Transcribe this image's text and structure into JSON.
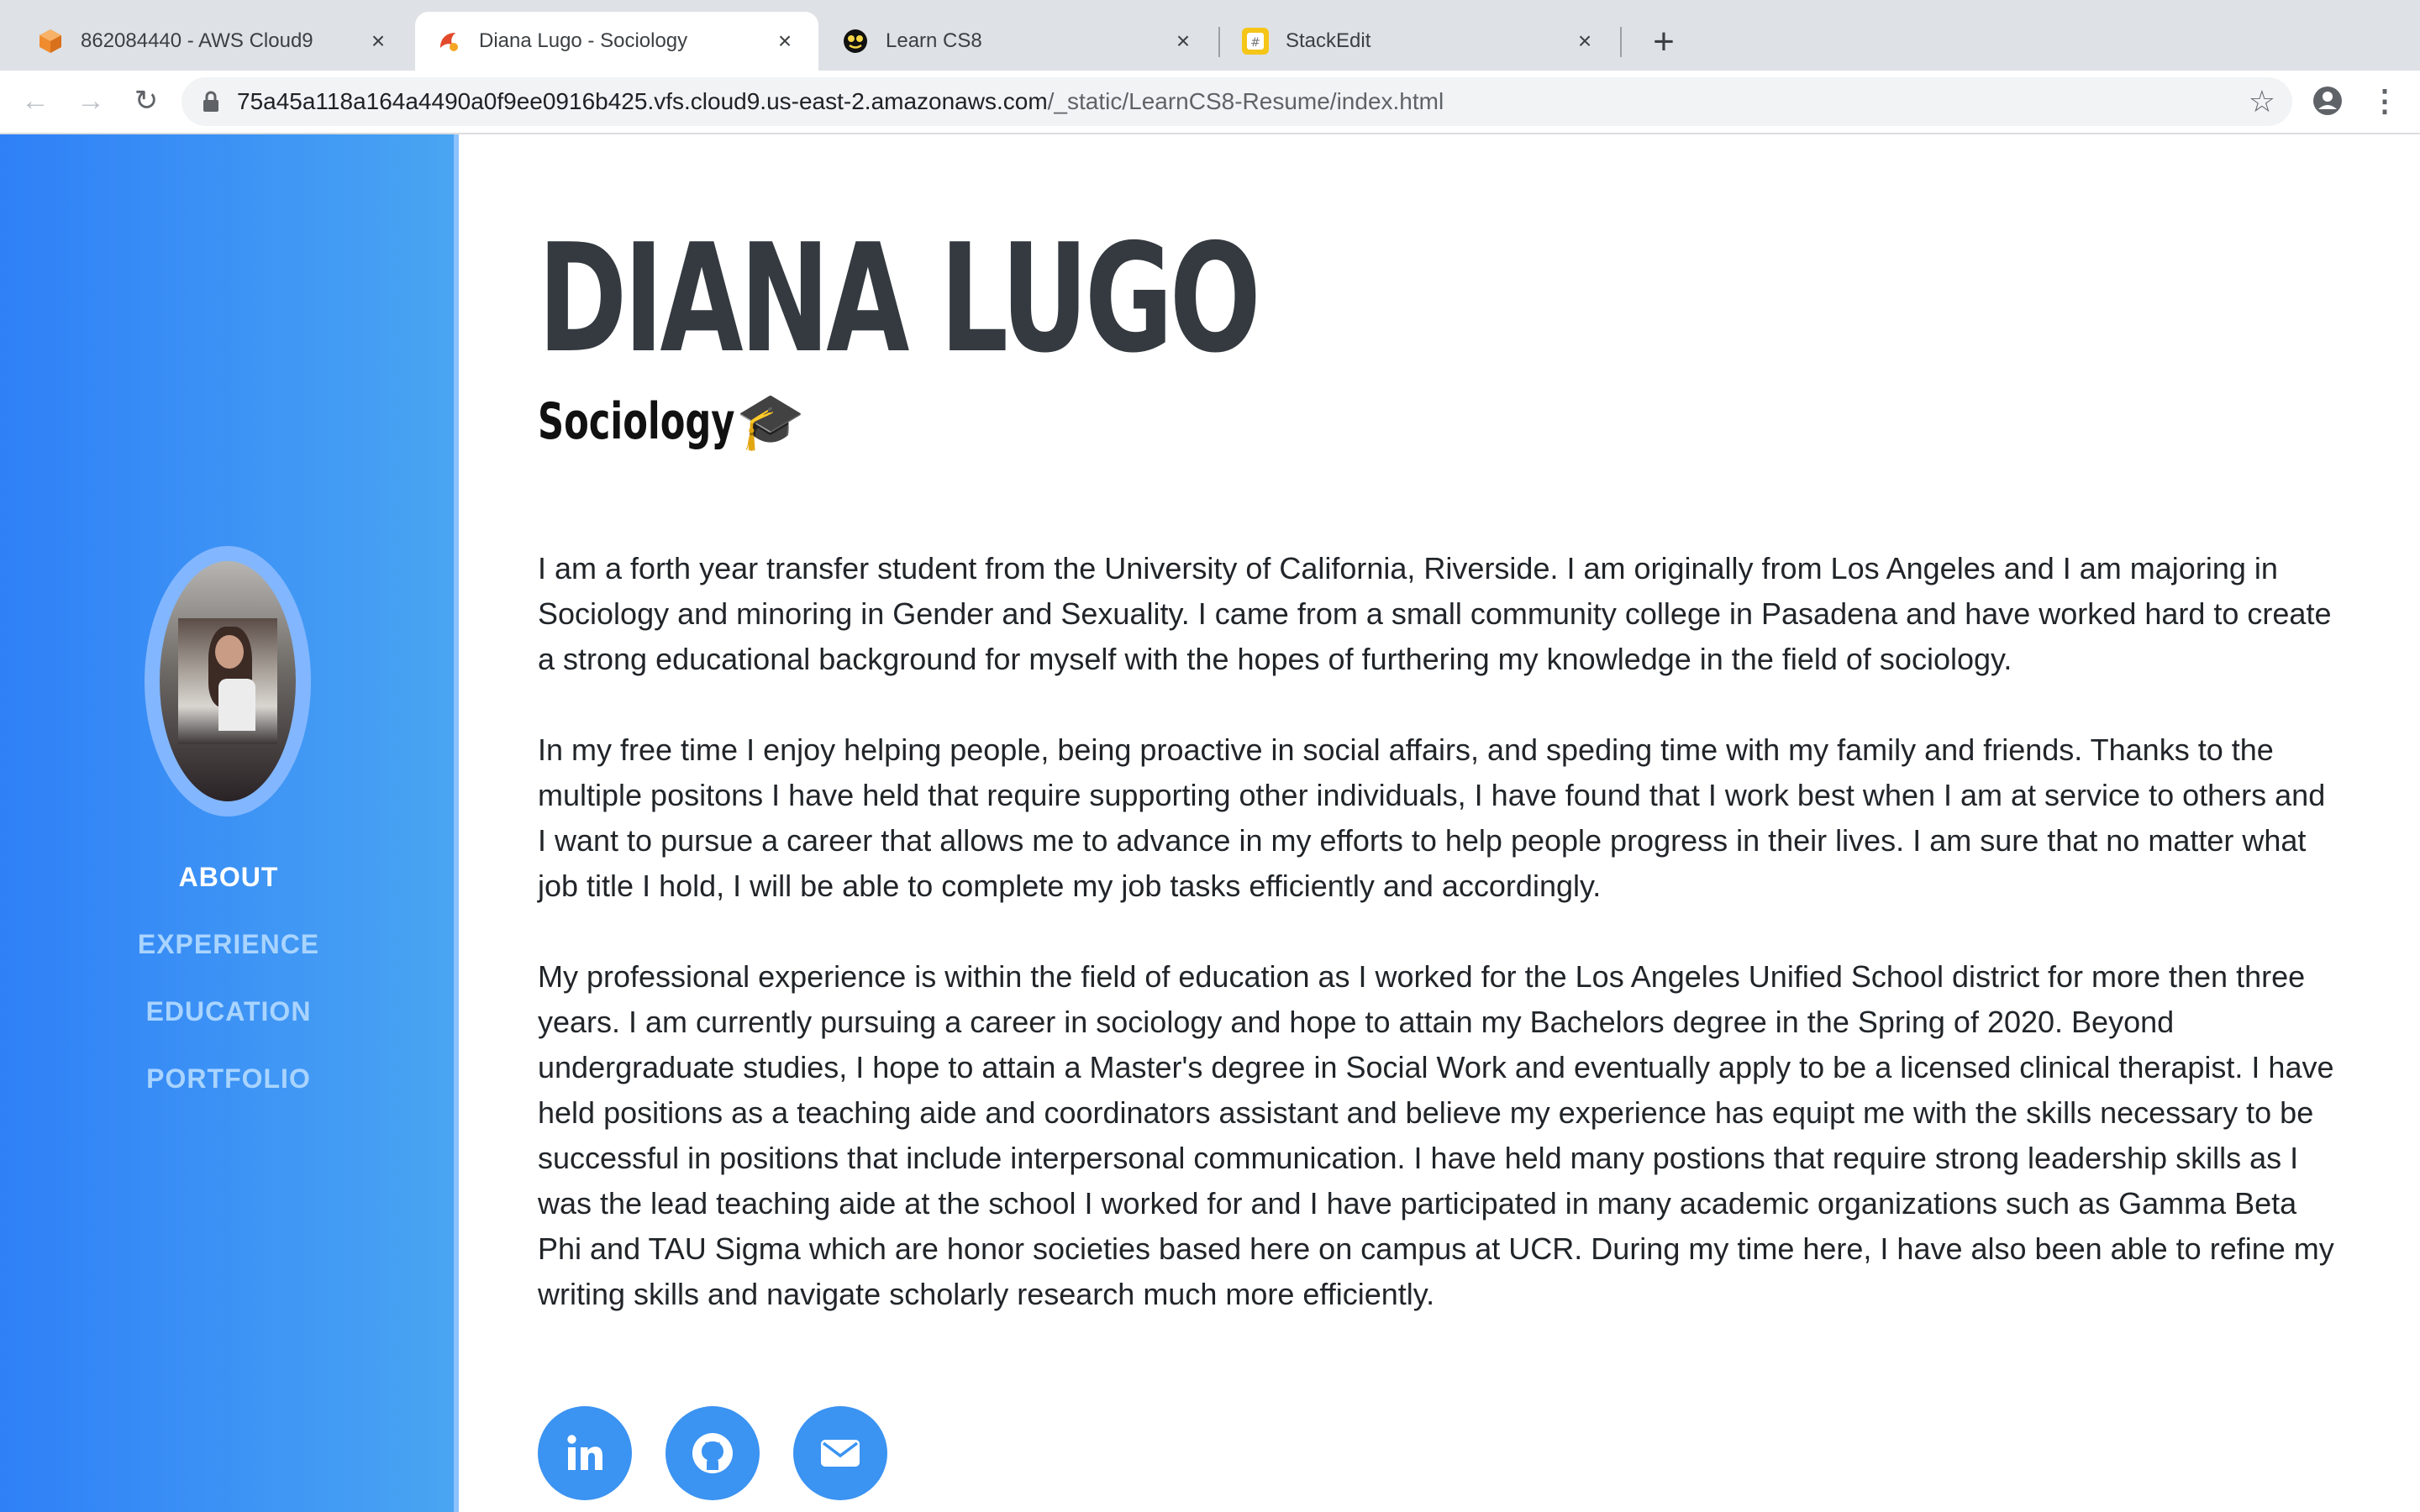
{
  "browser": {
    "tabs": [
      {
        "title": "862084440 - AWS Cloud9",
        "icon": "aws-cloud9-icon",
        "close": "×"
      },
      {
        "title": "Diana Lugo - Sociology",
        "icon": "page-favicon-icon",
        "close": "×"
      },
      {
        "title": "Learn CS8",
        "icon": "learn-cs8-icon",
        "close": "×"
      },
      {
        "title": "StackEdit",
        "icon": "stackedit-icon",
        "close": "×"
      }
    ],
    "new_tab": "+",
    "url_host": "75a45a118a164a4490a0f9ee0916b425.vfs.cloud9.us-east-2.amazonaws.com",
    "url_path": "/_static/LearnCS8-Resume/index.html",
    "back": "←",
    "forward": "→",
    "reload": "↻",
    "bookmark": "☆",
    "menu": "⋮"
  },
  "sidebar": {
    "nav": [
      {
        "label": "ABOUT",
        "active": true
      },
      {
        "label": "EXPERIENCE",
        "active": false
      },
      {
        "label": "EDUCATION",
        "active": false
      },
      {
        "label": "PORTFOLIO",
        "active": false
      }
    ]
  },
  "main": {
    "name": "DIANA LUGO",
    "subtitle": "Sociology",
    "subtitle_emoji": "🎓",
    "paragraphs": [
      "I am a forth year transfer student from the University of California, Riverside. I am originally from Los Angeles and I am majoring in Sociology and minoring in Gender and Sexuality. I came from a small community college in Pasadena and have worked hard to create a strong educational background for myself with the hopes of furthering my knowledge in the field of sociology.",
      "In my free time I enjoy helping people, being proactive in social affairs, and speding time with my family and friends. Thanks to the multiple positons I have held that require supporting other individuals, I have found that I work best when I am at service to others and I want to pursue a career that allows me to advance in my efforts to help people progress in their lives. I am sure that no matter what job title I hold, I will be able to complete my job tasks efficiently and accordingly.",
      "My professional experience is within the field of education as I worked for the Los Angeles Unified School district for more then three years. I am currently pursuing a career in sociology and hope to attain my Bachelors degree in the Spring of 2020. Beyond undergraduate studies, I hope to attain a Master's degree in Social Work and eventually apply to be a licensed clinical therapist. I have held positions as a teaching aide and coordinators assistant and believe my experience has equipt me with the skills necessary to be successful in positions that include interpersonal communication. I have held many postions that require strong leadership skills as I was the lead teaching aide at the school I worked for and I have participated in many academic organizations such as Gamma Beta Phi and TAU Sigma which are honor societies based here on campus at UCR. During my time here, I have also been able to refine my writing skills and navigate scholarly research much more efficiently."
    ],
    "social_links": [
      {
        "icon": "linkedin-icon"
      },
      {
        "icon": "github-icon"
      },
      {
        "icon": "email-icon"
      }
    ]
  },
  "colors": {
    "sidebar_start": "#2f80f7",
    "sidebar_end": "#4aa5f2",
    "accent": "#3b93f2",
    "heading": "#343a40",
    "nav_inactive": "#a9d4ff"
  }
}
